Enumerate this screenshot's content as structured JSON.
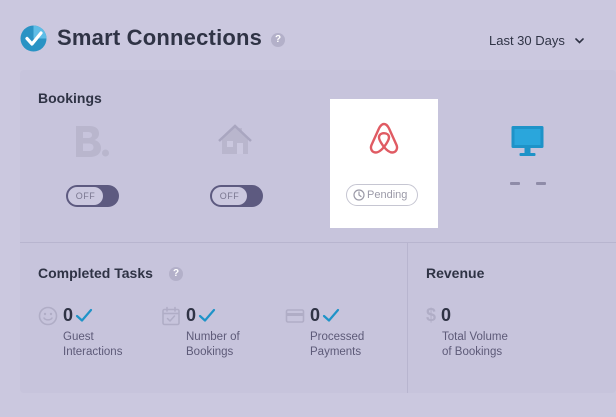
{
  "header": {
    "title": "Smart Connections",
    "help_glyph": "?",
    "date_range": "Last 30 Days"
  },
  "bookings": {
    "label": "Bookings",
    "channels": [
      {
        "icon": "booking-com-icon",
        "toggle_label": "OFF"
      },
      {
        "icon": "homeaway-icon",
        "toggle_label": "OFF"
      },
      {
        "icon": "airbnb-icon",
        "status": "Pending"
      },
      {
        "icon": "desktop-monitor-icon",
        "status_placeholder": "- -"
      }
    ]
  },
  "completed_tasks": {
    "label": "Completed Tasks",
    "help_glyph": "?",
    "stats": [
      {
        "icon": "smiley-icon",
        "value": "0",
        "label_line1": "Guest",
        "label_line2": "Interactions"
      },
      {
        "icon": "calendar-check-icon",
        "value": "0",
        "label_line1": "Number of",
        "label_line2": "Bookings"
      },
      {
        "icon": "credit-card-icon",
        "value": "0",
        "label_line1": "Processed",
        "label_line2": "Payments"
      }
    ]
  },
  "revenue": {
    "label": "Revenue",
    "currency": "$",
    "value": "0",
    "label_line1": "Total Volume",
    "label_line2": "of Bookings"
  },
  "colors": {
    "background": "#cbc8df",
    "card": "#c7c4dc",
    "accent_blue": "#1e93c8",
    "airbnb": "#e05b63",
    "toggle_off": "#5d5a80",
    "text_dark": "#2f3345"
  }
}
